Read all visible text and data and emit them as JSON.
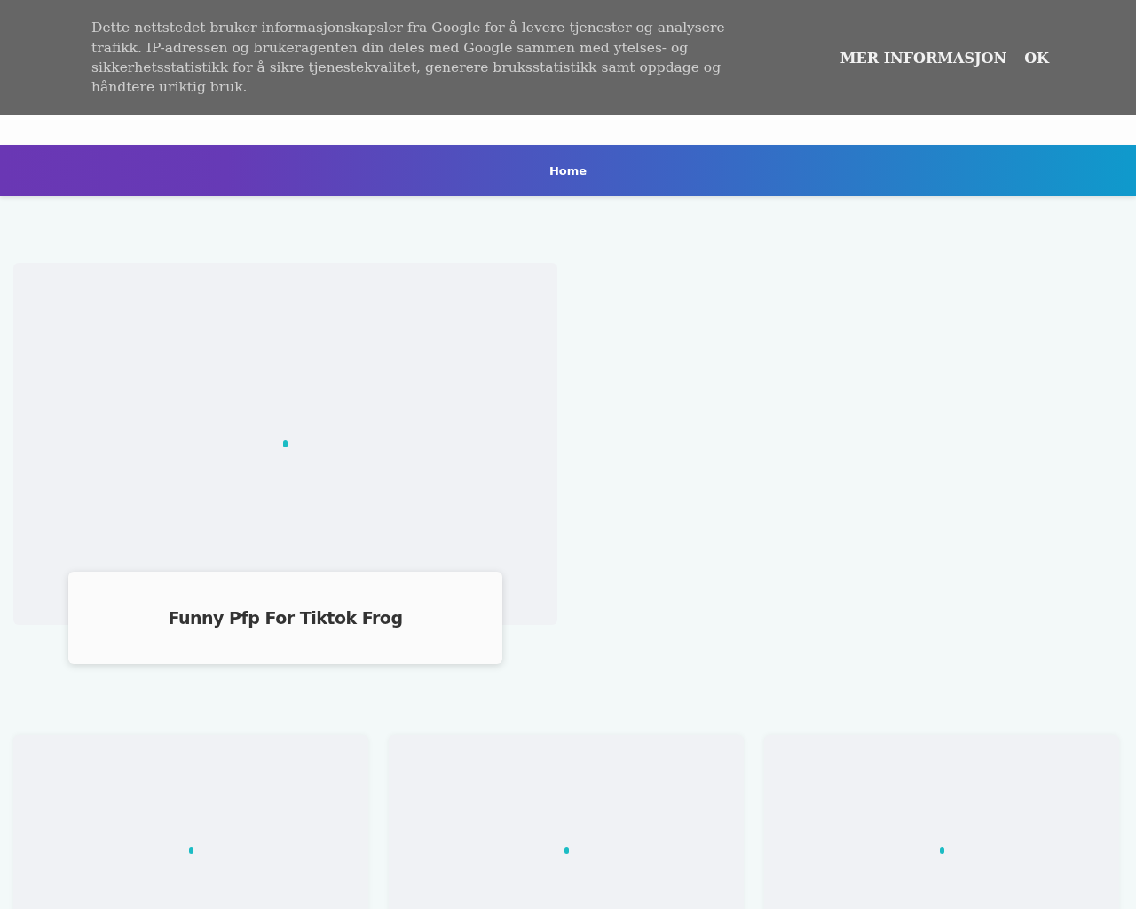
{
  "cookie_banner": {
    "text": "Dette nettstedet bruker informasjonskapsler fra Google for å levere tjenester og analysere trafikk. IP-adressen og brukeragenten din deles med Google sammen med ytelses- og sikkerhetsstatistikk for å sikre tjenestekvalitet, generere bruksstatistikk samt oppdage og håndtere uriktig bruk.",
    "buttons": [
      "MER INFORMASJON",
      "OK"
    ]
  },
  "nav": {
    "items": [
      {
        "label": "Home",
        "selected": true
      }
    ]
  },
  "featured_post": {
    "title": "Funny Pfp For Tiktok Frog",
    "image": {
      "kind": "loading"
    }
  },
  "posts": [
    {
      "image": {
        "kind": "loading"
      }
    },
    {
      "image": {
        "kind": "loading"
      }
    },
    {
      "image": {
        "kind": "loading"
      }
    }
  ]
}
